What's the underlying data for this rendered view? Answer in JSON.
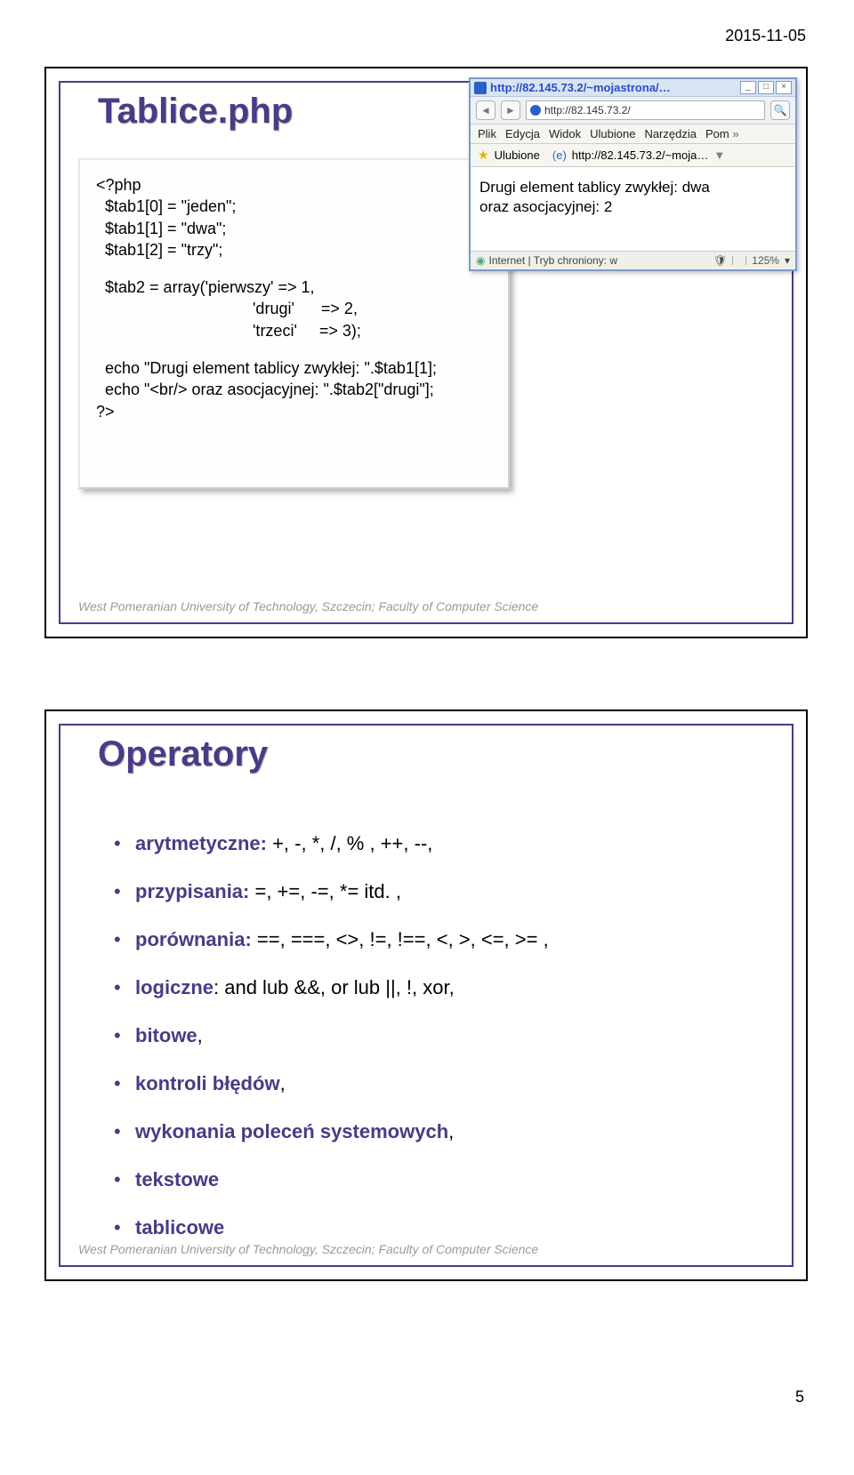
{
  "date": "2015-11-05",
  "page_number": "5",
  "footer": "West Pomeranian University of Technology, Szczecin; Faculty of Computer Science",
  "slide1": {
    "title": "Tablice.php",
    "code": {
      "l1": "<?php",
      "l2": "  $tab1[0] = \"jeden\";",
      "l3": "  $tab1[1] = \"dwa\";",
      "l4": "  $tab1[2] = \"trzy\";",
      "l5": "  $tab2 = array('pierwszy' => 1,",
      "l6": "'drugi'      => 2,",
      "l7": "'trzeci'     => 3);",
      "l8": "  echo \"Drugi element tablicy zwykłej: \".$tab1[1];",
      "l9": "  echo \"<br/> oraz asocjacyjnej: \".$tab2[\"drugi\"];",
      "l10": "?>"
    },
    "browser": {
      "title_url": "http://82.145.73.2/~mojastrona/…",
      "addr": "http://82.145.73.2/",
      "menu": {
        "m1": "Plik",
        "m2": "Edycja",
        "m3": "Widok",
        "m4": "Ulubione",
        "m5": "Narzędzia",
        "m6": "Pom"
      },
      "fav_label": "Ulubione",
      "fav_item": "http://82.145.73.2/~moja…",
      "content_line1": "Drugi element tablicy zwykłej: dwa",
      "content_line2": "oraz asocjacyjnej: 2",
      "status_left": "Internet | Tryb chroniony: w",
      "zoom": "125%",
      "winbtn_min": "_",
      "winbtn_max": "□",
      "winbtn_close": "×"
    }
  },
  "slide2": {
    "title": "Operatory",
    "items": [
      {
        "label": "arytmetyczne:",
        "rest": " +, -, *, /, % , ++, --,"
      },
      {
        "label": "przypisania:",
        "rest": " =, +=, -=, *= itd. ,"
      },
      {
        "label": "porównania:",
        "rest": " ==, ===, <>, !=, !==, <, >, <=, >= ,"
      },
      {
        "label": "logiczne",
        "rest": ": and lub &&,  or lub ||, !, xor,"
      },
      {
        "label": "bitowe",
        "rest": ","
      },
      {
        "label": "kontroli błędów",
        "rest": ","
      },
      {
        "label": "wykonania poleceń systemowych",
        "rest": ","
      },
      {
        "label": "tekstowe",
        "rest": ""
      },
      {
        "label": "tablicowe",
        "rest": ""
      }
    ]
  }
}
